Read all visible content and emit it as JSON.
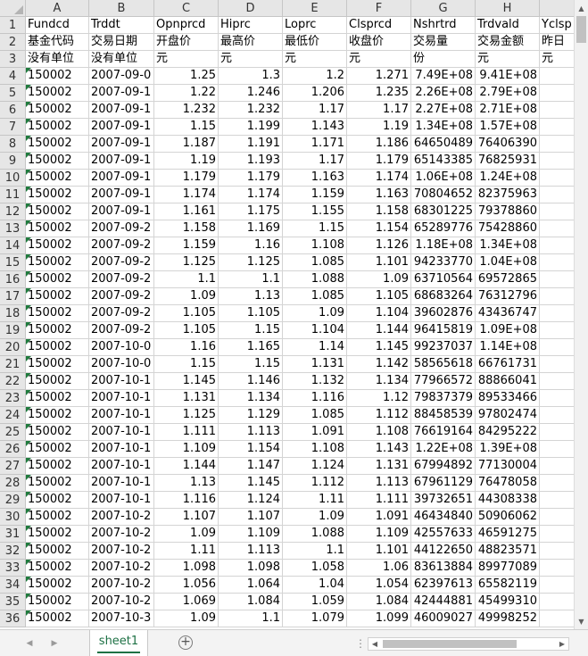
{
  "columns": [
    "A",
    "B",
    "C",
    "D",
    "E",
    "F",
    "G",
    "H",
    ""
  ],
  "row_numbers": [
    "1",
    "2",
    "3",
    "4",
    "5",
    "6",
    "7",
    "8",
    "9",
    "10",
    "11",
    "12",
    "13",
    "14",
    "15",
    "16",
    "17",
    "18",
    "19",
    "20",
    "21",
    "22",
    "23",
    "24",
    "25",
    "26",
    "27",
    "28",
    "29",
    "30",
    "31",
    "32",
    "33",
    "34",
    "35",
    "36"
  ],
  "header_rows": [
    [
      "Fundcd",
      "Trddt",
      "Opnprcd",
      "Hiprc",
      "Loprc",
      "Clsprcd",
      "Nshrtrd",
      "Trdvald",
      "Yclsp"
    ],
    [
      "基金代码",
      "交易日期",
      "开盘价",
      "最高价",
      "最低价",
      "收盘价",
      "交易量",
      "交易金额",
      "昨日"
    ],
    [
      "没有单位",
      "没有单位",
      "元",
      "元",
      "元",
      "元",
      "份",
      "元",
      "元"
    ]
  ],
  "data_rows": [
    [
      "150002",
      "2007-09-0",
      "1.25",
      "1.3",
      "1.2",
      "1.271",
      "7.49E+08",
      "9.41E+08",
      ""
    ],
    [
      "150002",
      "2007-09-1",
      "1.22",
      "1.246",
      "1.206",
      "1.235",
      "2.26E+08",
      "2.79E+08",
      ""
    ],
    [
      "150002",
      "2007-09-1",
      "1.232",
      "1.232",
      "1.17",
      "1.17",
      "2.27E+08",
      "2.71E+08",
      ""
    ],
    [
      "150002",
      "2007-09-1",
      "1.15",
      "1.199",
      "1.143",
      "1.19",
      "1.34E+08",
      "1.57E+08",
      ""
    ],
    [
      "150002",
      "2007-09-1",
      "1.187",
      "1.191",
      "1.171",
      "1.186",
      "64650489",
      "76406390",
      ""
    ],
    [
      "150002",
      "2007-09-1",
      "1.19",
      "1.193",
      "1.17",
      "1.179",
      "65143385",
      "76825931",
      ""
    ],
    [
      "150002",
      "2007-09-1",
      "1.179",
      "1.179",
      "1.163",
      "1.174",
      "1.06E+08",
      "1.24E+08",
      ""
    ],
    [
      "150002",
      "2007-09-1",
      "1.174",
      "1.174",
      "1.159",
      "1.163",
      "70804652",
      "82375963",
      ""
    ],
    [
      "150002",
      "2007-09-1",
      "1.161",
      "1.175",
      "1.155",
      "1.158",
      "68301225",
      "79378860",
      ""
    ],
    [
      "150002",
      "2007-09-2",
      "1.158",
      "1.169",
      "1.15",
      "1.154",
      "65289776",
      "75428860",
      ""
    ],
    [
      "150002",
      "2007-09-2",
      "1.159",
      "1.16",
      "1.108",
      "1.126",
      "1.18E+08",
      "1.34E+08",
      ""
    ],
    [
      "150002",
      "2007-09-2",
      "1.125",
      "1.125",
      "1.085",
      "1.101",
      "94233770",
      "1.04E+08",
      ""
    ],
    [
      "150002",
      "2007-09-2",
      "1.1",
      "1.1",
      "1.088",
      "1.09",
      "63710564",
      "69572865",
      ""
    ],
    [
      "150002",
      "2007-09-2",
      "1.09",
      "1.13",
      "1.085",
      "1.105",
      "68683264",
      "76312796",
      ""
    ],
    [
      "150002",
      "2007-09-2",
      "1.105",
      "1.105",
      "1.09",
      "1.104",
      "39602876",
      "43436747",
      ""
    ],
    [
      "150002",
      "2007-09-2",
      "1.105",
      "1.15",
      "1.104",
      "1.144",
      "96415819",
      "1.09E+08",
      ""
    ],
    [
      "150002",
      "2007-10-0",
      "1.16",
      "1.165",
      "1.14",
      "1.145",
      "99237037",
      "1.14E+08",
      ""
    ],
    [
      "150002",
      "2007-10-0",
      "1.15",
      "1.15",
      "1.131",
      "1.142",
      "58565618",
      "66761731",
      ""
    ],
    [
      "150002",
      "2007-10-1",
      "1.145",
      "1.146",
      "1.132",
      "1.134",
      "77966572",
      "88866041",
      ""
    ],
    [
      "150002",
      "2007-10-1",
      "1.131",
      "1.134",
      "1.116",
      "1.12",
      "79837379",
      "89533466",
      ""
    ],
    [
      "150002",
      "2007-10-1",
      "1.125",
      "1.129",
      "1.085",
      "1.112",
      "88458539",
      "97802474",
      ""
    ],
    [
      "150002",
      "2007-10-1",
      "1.111",
      "1.113",
      "1.091",
      "1.108",
      "76619164",
      "84295222",
      ""
    ],
    [
      "150002",
      "2007-10-1",
      "1.109",
      "1.154",
      "1.108",
      "1.143",
      "1.22E+08",
      "1.39E+08",
      ""
    ],
    [
      "150002",
      "2007-10-1",
      "1.144",
      "1.147",
      "1.124",
      "1.131",
      "67994892",
      "77130004",
      ""
    ],
    [
      "150002",
      "2007-10-1",
      "1.13",
      "1.145",
      "1.112",
      "1.113",
      "67961129",
      "76478058",
      ""
    ],
    [
      "150002",
      "2007-10-1",
      "1.116",
      "1.124",
      "1.11",
      "1.111",
      "39732651",
      "44308338",
      ""
    ],
    [
      "150002",
      "2007-10-2",
      "1.107",
      "1.107",
      "1.09",
      "1.091",
      "46434840",
      "50906062",
      ""
    ],
    [
      "150002",
      "2007-10-2",
      "1.09",
      "1.109",
      "1.088",
      "1.109",
      "42557633",
      "46591275",
      ""
    ],
    [
      "150002",
      "2007-10-2",
      "1.11",
      "1.113",
      "1.1",
      "1.101",
      "44122650",
      "48823571",
      ""
    ],
    [
      "150002",
      "2007-10-2",
      "1.098",
      "1.098",
      "1.058",
      "1.06",
      "83613884",
      "89977089",
      ""
    ],
    [
      "150002",
      "2007-10-2",
      "1.056",
      "1.064",
      "1.04",
      "1.054",
      "62397613",
      "65582119",
      ""
    ],
    [
      "150002",
      "2007-10-2",
      "1.069",
      "1.084",
      "1.059",
      "1.084",
      "42444881",
      "45499310",
      ""
    ],
    [
      "150002",
      "2007-10-3",
      "1.09",
      "1.1",
      "1.079",
      "1.099",
      "46009027",
      "49998252",
      ""
    ]
  ],
  "sheet_tab": "sheet1",
  "add_sheet_symbol": "+",
  "accent_color": "#1e7145",
  "icons": {
    "scroll_up": "triangle-up-icon",
    "scroll_down": "triangle-down-icon",
    "scroll_left": "triangle-left-icon",
    "scroll_right": "triangle-right-icon",
    "sheet_nav_prev": "sheet-prev-icon",
    "sheet_nav_next": "sheet-next-icon",
    "add_sheet": "plus-circle-icon"
  }
}
